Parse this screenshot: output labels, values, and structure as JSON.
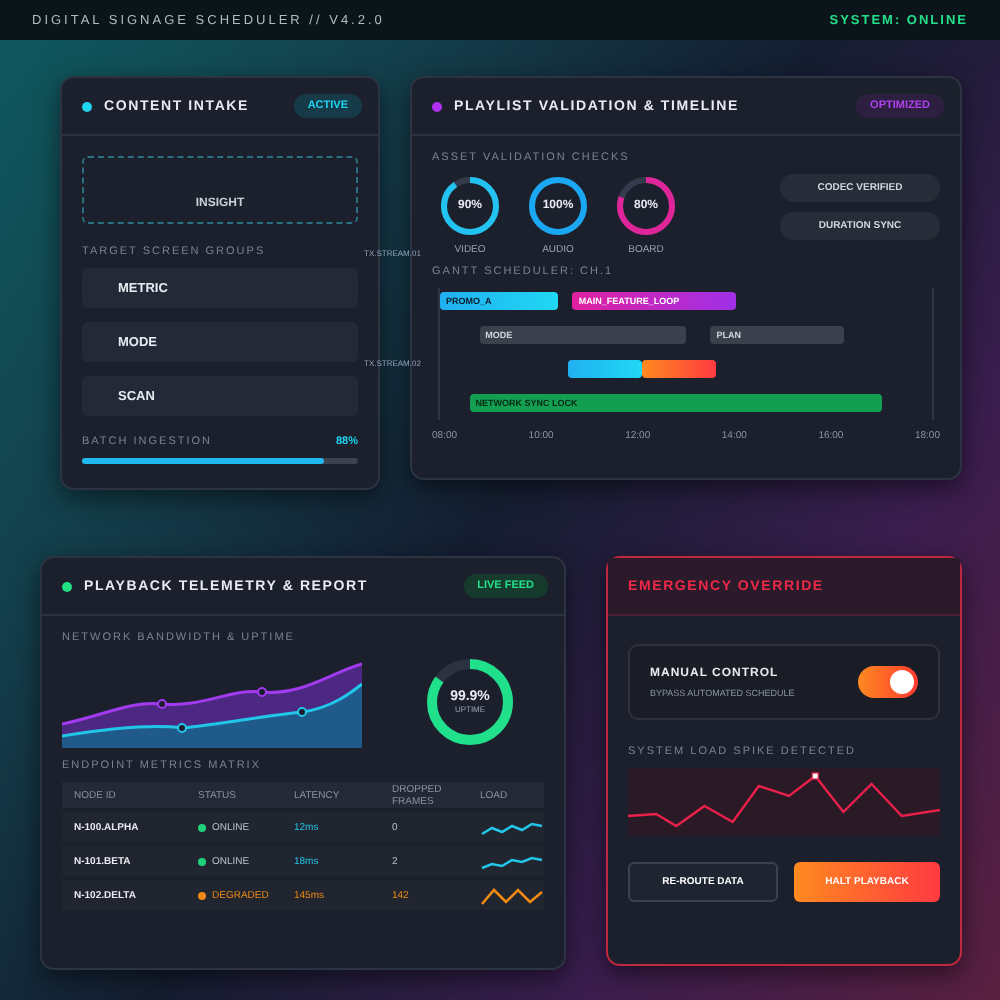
{
  "header": {
    "title": "DIGITAL SIGNAGE SCHEDULER // V4.2.0",
    "status": "SYSTEM: ONLINE"
  },
  "connectors": [
    "TX.STREAM.01",
    "TX.STREAM.02"
  ],
  "intake": {
    "title": "CONTENT INTAKE",
    "badge": "ACTIVE",
    "drop_zone": "INSIGHT",
    "groups_label": "TARGET SCREEN GROUPS",
    "groups": [
      {
        "label": "METRIC"
      },
      {
        "label": "MODE"
      },
      {
        "label": "SCAN"
      }
    ],
    "batch": {
      "label": "BATCH INGESTION",
      "reading": "88%",
      "level": 0.88
    }
  },
  "playlist": {
    "title": "PLAYLIST VALIDATION & TIMELINE",
    "badge": "OPTIMIZED",
    "checks_label": "ASSET VALIDATION CHECKS",
    "rings": [
      {
        "value": "90%",
        "label": "VIDEO",
        "level": 0.9,
        "color": "#22c3f0"
      },
      {
        "value": "100%",
        "label": "AUDIO",
        "level": 1,
        "color": "#1aa8f5"
      },
      {
        "value": "80%",
        "label": "BOARD",
        "level": 0.8,
        "color": "#e0259a"
      }
    ],
    "pills": [
      "CODEC VERIFIED",
      "DURATION SYNC"
    ],
    "gantt_label": "GANTT SCHEDULER: CH.1",
    "bars": [
      {
        "label": "PROMO_A",
        "kind": "cyan"
      },
      {
        "label": "MAIN_FEATURE_LOOP",
        "kind": "magenta"
      },
      {
        "label": "MODE",
        "kind": "grey"
      },
      {
        "label": "PLAN",
        "kind": "grey"
      },
      {
        "kind": "cyan"
      },
      {
        "kind": "orange"
      },
      {
        "label": "NETWORK SYNC LOCK",
        "kind": "green"
      }
    ],
    "ticks": [
      "08:00",
      "10:00",
      "12:00",
      "14:00",
      "16:00",
      "18:00"
    ]
  },
  "telemetry": {
    "title": "PLAYBACK TELEMETRY & REPORT",
    "badge": "LIVE FEED",
    "bandwidth_label": "NETWORK BANDWIDTH & UPTIME",
    "uptime": {
      "value": "99.9%",
      "label": "UPTIME",
      "level": 0.85
    },
    "matrix_label": "ENDPOINT METRICS MATRIX",
    "columns": [
      "NODE ID",
      "STATUS",
      "LATENCY",
      "DROPPED FRAMES",
      "LOAD"
    ],
    "rows": [
      {
        "node": "N-100.ALPHA",
        "status": "ONLINE",
        "latency": "12ms",
        "dropped": "0",
        "color": "#1fd17a"
      },
      {
        "node": "N-101.BETA",
        "status": "ONLINE",
        "latency": "18ms",
        "dropped": "2",
        "color": "#1fd17a"
      },
      {
        "node": "N-102.DELTA",
        "status": "DEGRADED",
        "latency": "145ms",
        "dropped": "142",
        "color": "#f08a12"
      }
    ]
  },
  "emergency": {
    "title": "EMERGENCY OVERRIDE",
    "control": {
      "label": "MANUAL CONTROL",
      "hint": "BYPASS AUTOMATED SCHEDULE",
      "on": true
    },
    "spike_label": "SYSTEM LOAD SPIKE DETECTED",
    "buttons": [
      "RE-ROUTE DATA",
      "HALT PLAYBACK"
    ]
  }
}
